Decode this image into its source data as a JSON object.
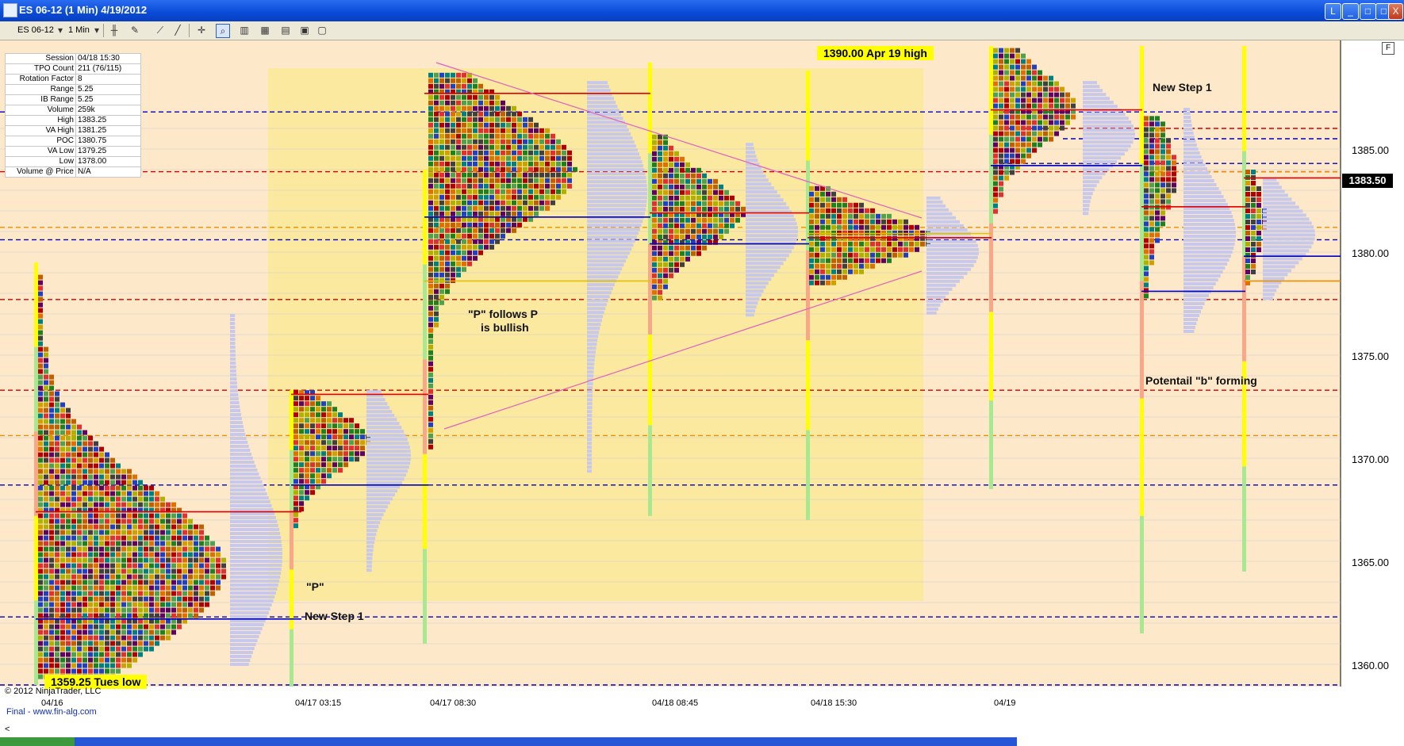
{
  "window": {
    "title": "ES 06-12 (1 Min)  4/19/2012",
    "buttons": [
      "L",
      "_",
      "□",
      "□",
      "X"
    ]
  },
  "toolbar": {
    "instrument": "ES 06-12",
    "interval": "1 Min"
  },
  "info_panel": [
    {
      "label": "Session",
      "value": "04/18 15:30"
    },
    {
      "label": "TPO Count",
      "value": "211 (76/115)"
    },
    {
      "label": "Rotation Factor",
      "value": "8"
    },
    {
      "label": "Range",
      "value": "5.25"
    },
    {
      "label": "IB Range",
      "value": "5.25"
    },
    {
      "label": "Volume",
      "value": "259k"
    },
    {
      "label": "High",
      "value": "1383.25"
    },
    {
      "label": "VA High",
      "value": "1381.25"
    },
    {
      "label": "POC",
      "value": "1380.75"
    },
    {
      "label": "VA Low",
      "value": "1379.25"
    },
    {
      "label": "Low",
      "value": "1378.00"
    },
    {
      "label": "Volume @ Price",
      "value": "N/A"
    }
  ],
  "annotations": {
    "apr19_high": "1390.00 Apr 19 high",
    "tues_low": "1359.25 Tues low",
    "p_follows_1": "\"P\" follows P",
    "p_follows_2": "is bullish",
    "p_label": "\"P\"",
    "new_step_left": "New Step 1",
    "new_step_right": "New Step 1",
    "potential_b": "Potentail \"b\" forming"
  },
  "price_axis": [
    "1385.00",
    "1380.00",
    "1375.00",
    "1370.00",
    "1365.00",
    "1360.00"
  ],
  "current_price": "1383.50",
  "time_axis": [
    "04/16",
    "04/17 03:15",
    "04/17 08:30",
    "04/18 08:45",
    "04/18 15:30",
    "04/19"
  ],
  "panel_button": "F",
  "footer": {
    "copyright": "© 2012 NinjaTrader, LLC",
    "source": "Final - www.fin-alg.com",
    "scroll": "<"
  },
  "colors": {
    "chart_bg": "#fde9c9",
    "highlight_bg": "#fbe9a0",
    "poc_red": "#e00000",
    "va_blue": "#0000c0",
    "profile_lavender": "#c8c8ea",
    "trendline": "#e060c0"
  }
}
